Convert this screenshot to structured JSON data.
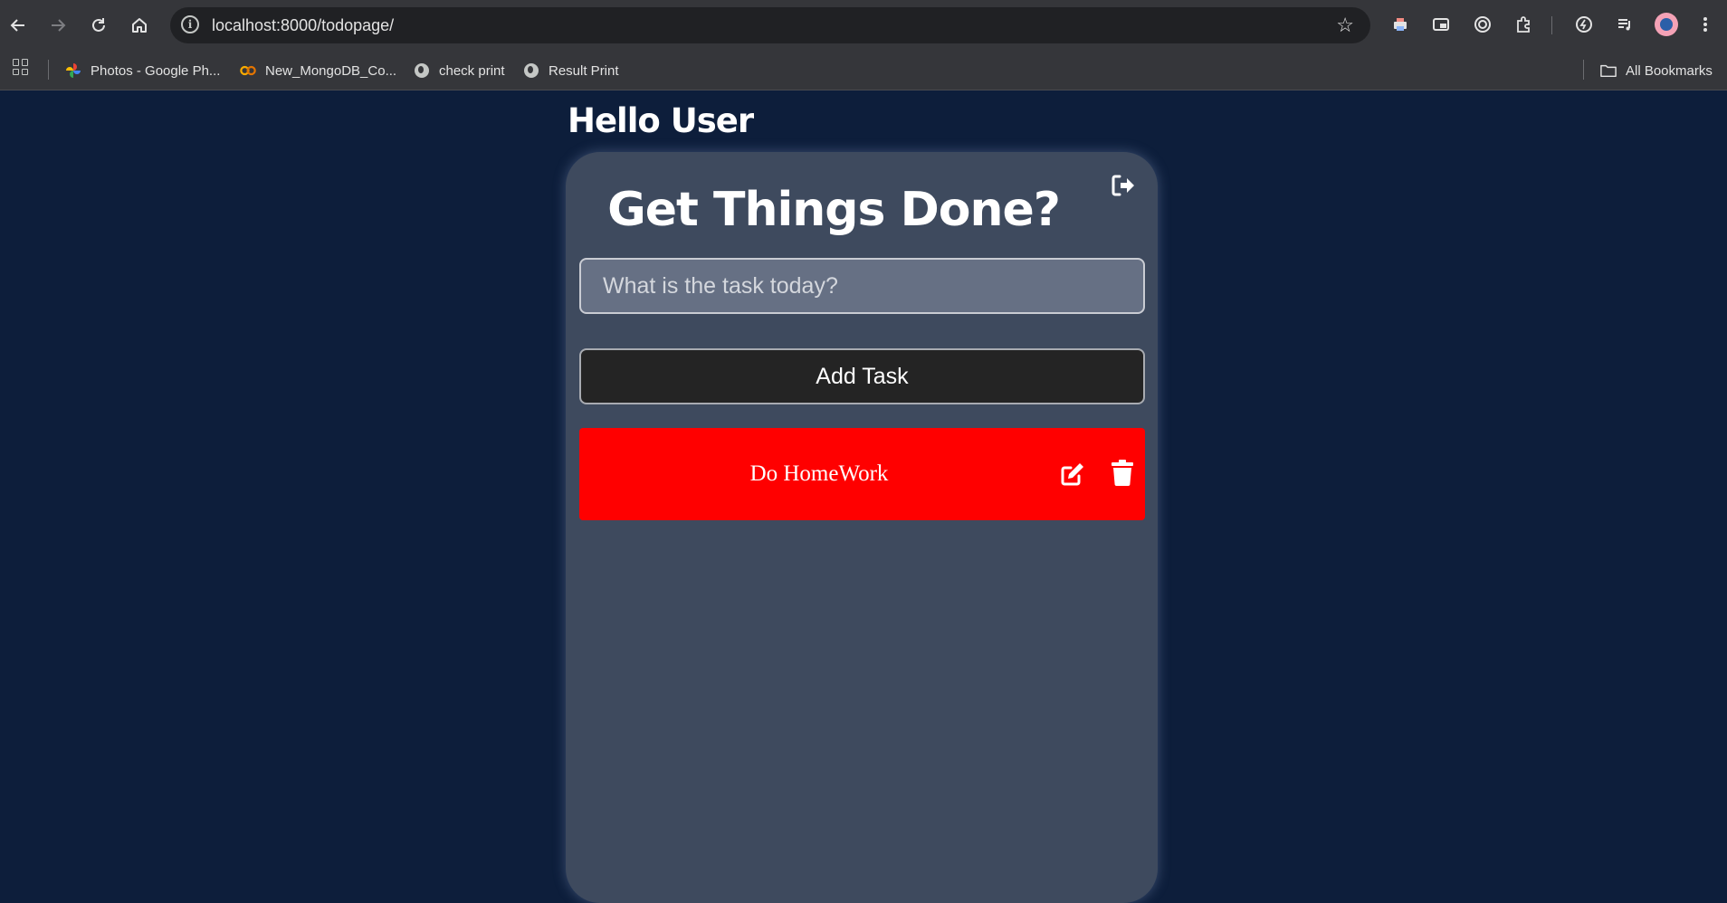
{
  "browser": {
    "url": "localhost:8000/todopage/",
    "bookmarks": [
      {
        "label": "Photos - Google Ph..."
      },
      {
        "label": "New_MongoDB_Co..."
      },
      {
        "label": "check print"
      },
      {
        "label": "Result Print"
      }
    ],
    "all_bookmarks_label": "All Bookmarks"
  },
  "page": {
    "greeting": "Hello User",
    "title": "Get Things Done?",
    "task_input_placeholder": "What is the task today?",
    "add_button_label": "Add Task",
    "tasks": [
      {
        "text": "Do HomeWork",
        "color": "#ff0000"
      }
    ]
  },
  "colors": {
    "background": "#0d1e3b",
    "card": "#3e4a5e",
    "task_item": "#ff0000",
    "add_button": "#242424"
  }
}
